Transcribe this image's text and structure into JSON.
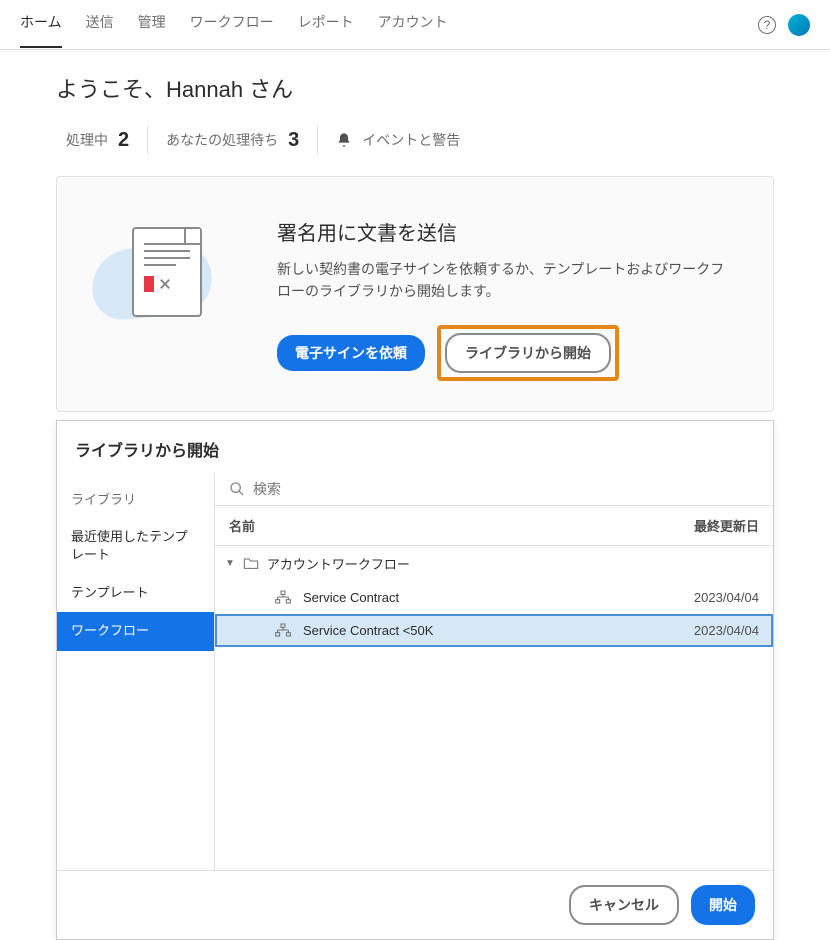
{
  "nav": {
    "tabs": [
      "ホーム",
      "送信",
      "管理",
      "ワークフロー",
      "レポート",
      "アカウント"
    ],
    "activeIndex": 0
  },
  "welcome": "ようこそ、Hannah さん",
  "stats": {
    "inProgressLabel": "処理中",
    "inProgressValue": "2",
    "waitingLabel": "あなたの処理待ち",
    "waitingValue": "3",
    "eventsLabel": "イベントと警告"
  },
  "hero": {
    "title": "署名用に文書を送信",
    "desc": "新しい契約書の電子サインを依頼するか、テンプレートおよびワークフローのライブラリから開始します。",
    "primaryBtn": "電子サインを依頼",
    "secondaryBtn": "ライブラリから開始"
  },
  "modal": {
    "title": "ライブラリから開始",
    "sidebar": {
      "groupLabel": "ライブラリ",
      "items": [
        "最近使用したテンプレート",
        "テンプレート",
        "ワークフロー"
      ],
      "selectedIndex": 2
    },
    "search": {
      "placeholder": "検索"
    },
    "tableHead": {
      "name": "名前",
      "date": "最終更新日"
    },
    "treeGroup": "アカウントワークフロー",
    "rows": [
      {
        "label": "Service Contract",
        "date": "2023/04/04",
        "selected": false
      },
      {
        "label": "Service Contract <50K",
        "date": "2023/04/04",
        "selected": true
      }
    ],
    "cancelBtn": "キャンセル",
    "startBtn": "開始"
  }
}
